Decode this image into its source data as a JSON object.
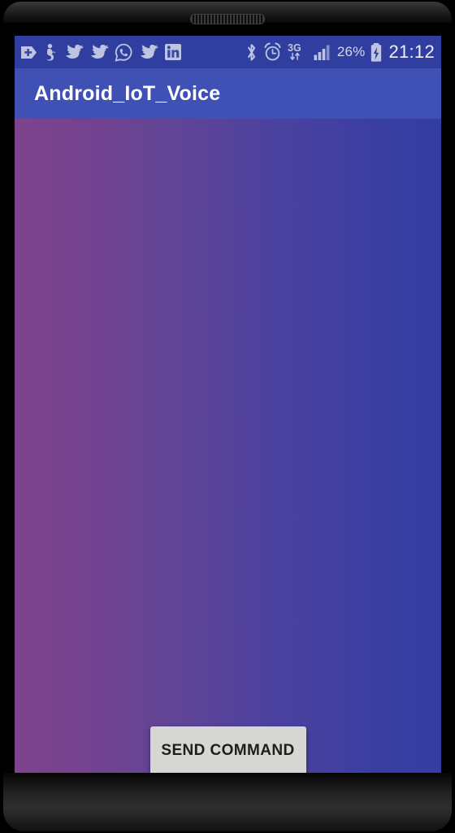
{
  "device": {
    "earpiece_label": "earpiece-speaker"
  },
  "status_bar": {
    "background_color": "#303f9f",
    "notification_icons": [
      {
        "name": "add-tag-icon",
        "label": "+"
      },
      {
        "name": "person-notification-icon",
        "label": ""
      },
      {
        "name": "twitter-icon",
        "label": ""
      },
      {
        "name": "twitter-icon",
        "label": ""
      },
      {
        "name": "whatsapp-icon",
        "label": ""
      },
      {
        "name": "twitter-icon",
        "label": ""
      },
      {
        "name": "linkedin-icon",
        "label": "in"
      }
    ],
    "system_icons": [
      {
        "name": "bluetooth-icon"
      },
      {
        "name": "alarm-clock-icon"
      },
      {
        "name": "mobile-data-3g-icon",
        "label": "3G"
      },
      {
        "name": "signal-bars-icon"
      }
    ],
    "battery_percent": "26%",
    "battery_state": "charging",
    "clock": "21:12"
  },
  "app_bar": {
    "title": "Android_IoT_Voice",
    "background_color": "#3f51b5",
    "text_color": "#ffffff"
  },
  "content": {
    "gradient_start_color": "#7e448d",
    "gradient_end_color": "#343da2",
    "send_button": {
      "label": "SEND COMMAND",
      "background_color": "#d6d7d2",
      "text_color": "#1d1d1d"
    }
  }
}
